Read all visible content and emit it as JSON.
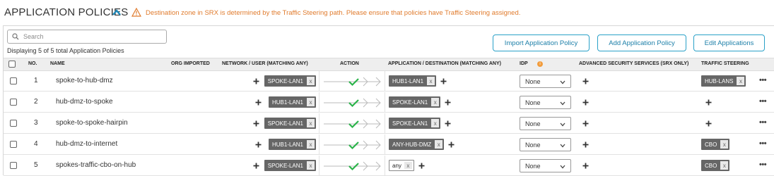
{
  "page": {
    "title": "APPLICATION POLICIES",
    "warning": "Destination zone in SRX is determined by the Traffic Steering path. Please ensure that policies have Traffic Steering assigned."
  },
  "search": {
    "placeholder": "Search",
    "value": ""
  },
  "count_text": "Displaying 5 of 5 total Application Policies",
  "buttons": {
    "import": "Import Application Policy",
    "add": "Add Application Policy",
    "edit": "Edit Applications"
  },
  "columns": {
    "no": "NO.",
    "name": "NAME",
    "org_imported": "ORG IMPORTED",
    "network": "NETWORK / USER (MATCHING ANY)",
    "action": "ACTION",
    "application": "APPLICATION / DESTINATION (MATCHING ANY)",
    "idp": "IDP",
    "advanced": "ADVANCED SECURITY SERVICES (SRX ONLY)",
    "traffic": "TRAFFIC STEERING"
  },
  "rows": [
    {
      "no": "1",
      "name": "spoke-to-hub-dmz",
      "network": "SPOKE-LAN1",
      "application": "HUB1-LAN1",
      "idp": "None",
      "traffic": "HUB-LANS"
    },
    {
      "no": "2",
      "name": "hub-dmz-to-spoke",
      "network": "HUB1-LAN1",
      "application": "SPOKE-LAN1",
      "idp": "None",
      "traffic": ""
    },
    {
      "no": "3",
      "name": "spoke-to-spoke-hairpin",
      "network": "SPOKE-LAN1",
      "application": "SPOKE-LAN1",
      "idp": "None",
      "traffic": ""
    },
    {
      "no": "4",
      "name": "hub-dmz-to-internet",
      "network": "HUB1-LAN1",
      "application": "ANY-HUB-DMZ",
      "idp": "None",
      "traffic": "CBO"
    },
    {
      "no": "5",
      "name": "spokes-traffic-cbo-on-hub",
      "network": "SPOKE-LAN1",
      "application": "any",
      "idp": "None",
      "traffic": "CBO"
    }
  ],
  "icons": {
    "collapse": "chevron-up-icon",
    "warning": "warning-triangle-icon",
    "search": "search-icon",
    "remove": "x",
    "add": "plus-icon",
    "allow": "check-icon",
    "menu": "more-icon"
  },
  "ui": {
    "more_glyph": "•••",
    "info_glyph": "i"
  },
  "colors": {
    "accent": "#1e88b8",
    "warning": "#e07b2d",
    "allow": "#2bb34a",
    "tag_dark": "#666666"
  }
}
